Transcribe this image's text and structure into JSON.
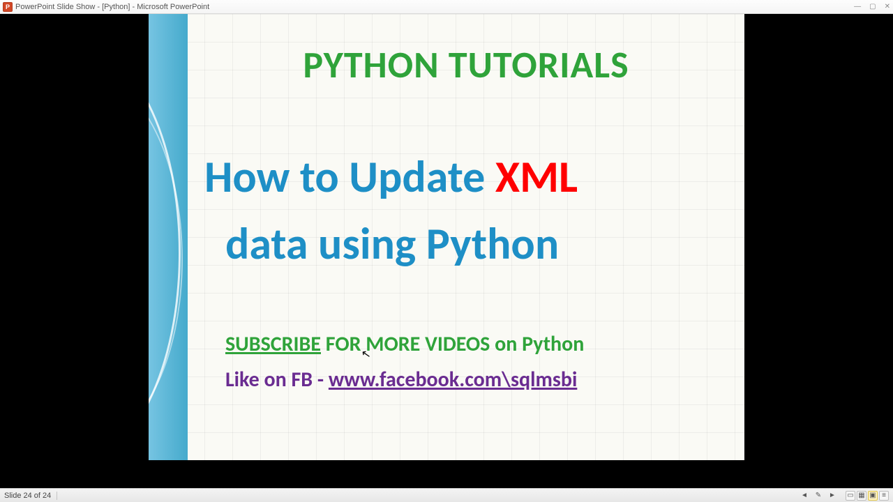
{
  "window": {
    "title": "PowerPoint Slide Show - [Python] - Microsoft PowerPoint",
    "app_icon_letter": "P",
    "controls": {
      "minimize": "—",
      "maximize": "▢",
      "close": "✕"
    }
  },
  "slide": {
    "heading_top": "PYTHON TUTORIALS",
    "main_line1_a": "How to Update ",
    "main_line1_b": "XML",
    "main_line2": "data using Python",
    "subscribe_word": "SUBSCRIBE",
    "subscribe_rest": " FOR MORE VIDEOS on Python",
    "fb_prefix": "Like on FB - ",
    "fb_link": "www.facebook.com\\sqlmsbi"
  },
  "status": {
    "slide_count": "Slide 24 of 24",
    "nav": {
      "prev": "◄",
      "pen": "✎",
      "next": "►"
    },
    "views": {
      "normal": "▭",
      "sorter": "▦",
      "show": "▣",
      "reading": "≡"
    }
  },
  "colors": {
    "brand_green": "#2fa33a",
    "brand_blue": "#1e8fc6",
    "brand_red": "#ff0000",
    "brand_purple": "#6a2c91",
    "band": "#45aacc"
  }
}
